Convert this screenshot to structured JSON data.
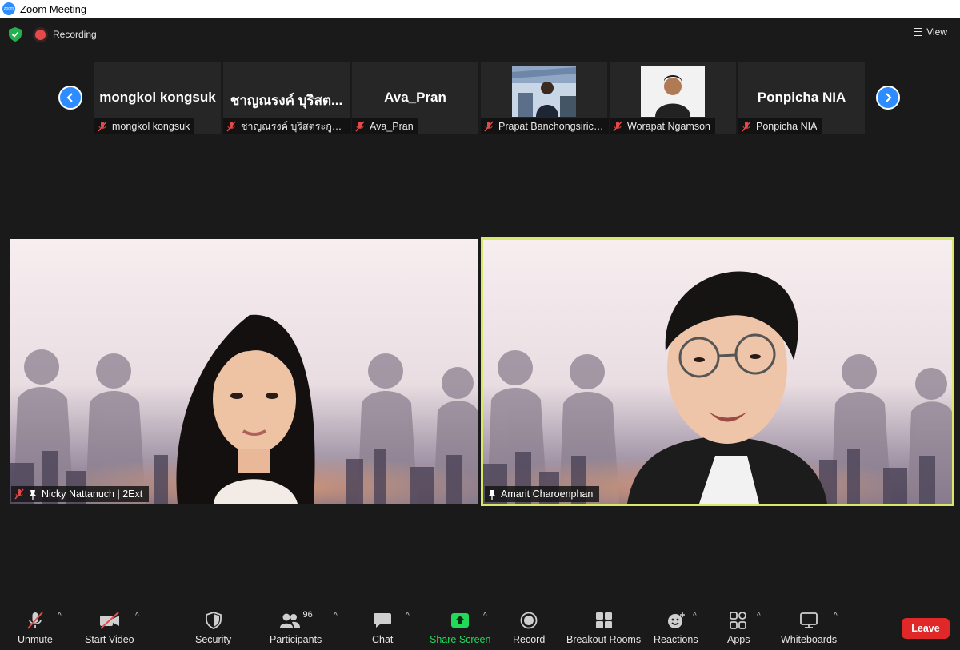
{
  "window": {
    "title": "Zoom Meeting",
    "logo_text": "zoom"
  },
  "topbar": {
    "recording_label": "Recording",
    "view_label": "View"
  },
  "gallery": [
    {
      "display": "mongkol kongsuk",
      "name": "mongkol kongsuk"
    },
    {
      "display": "ชาญณรงค์ บุริสต...",
      "name": "ชาญณรงค์ บุริสตระกูล หอ..."
    },
    {
      "display": "Ava_Pran",
      "name": "Ava_Pran"
    },
    {
      "display": "",
      "name": "Prapat Banchongsirich..."
    },
    {
      "display": "",
      "name": "Worapat Ngamson"
    },
    {
      "display": "Ponpicha NIA",
      "name": "Ponpicha NIA"
    }
  ],
  "videos": {
    "left": {
      "name": "Nicky Nattanuch | 2Ext"
    },
    "right": {
      "name": "Amarit Charoenphan"
    }
  },
  "toolbar": {
    "unmute": "Unmute",
    "start_video": "Start Video",
    "security": "Security",
    "participants": "Participants",
    "participants_count": "96",
    "chat": "Chat",
    "share_screen": "Share Screen",
    "record": "Record",
    "breakout_rooms": "Breakout Rooms",
    "reactions": "Reactions",
    "apps": "Apps",
    "whiteboards": "Whiteboards",
    "leave": "Leave"
  },
  "colors": {
    "accent": "#2d8cff",
    "share": "#23d959",
    "leave": "#e02828",
    "active_speaker": "#d9e86b",
    "muted": "#e54a4a"
  }
}
